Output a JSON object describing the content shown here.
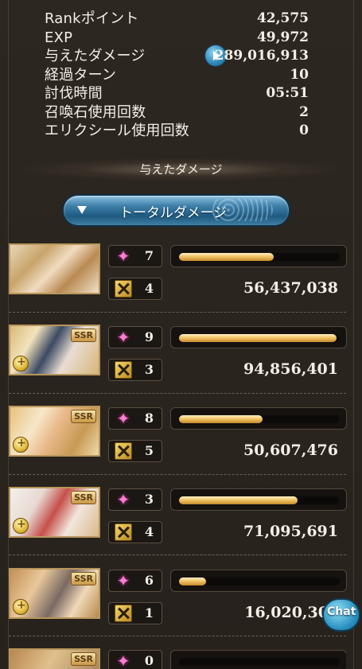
{
  "stats": [
    {
      "label": "Rankポイント",
      "value": "42,575"
    },
    {
      "label": "EXP",
      "value": "49,972"
    },
    {
      "label": "与えたダメージ",
      "value": "289,016,913"
    },
    {
      "label": "経過ターン",
      "value": "10"
    },
    {
      "label": "討伐時間",
      "value": "05:51"
    },
    {
      "label": "召喚石使用回数",
      "value": "2"
    },
    {
      "label": "エリクシール使用回数",
      "value": "0"
    }
  ],
  "section_title": "与えたダメージ",
  "dropdown_label": "トータルダメージ",
  "members": [
    {
      "ssr": "",
      "ability": "7",
      "special": "4",
      "damage": "56,437,038",
      "bar_fraction": 0.59
    },
    {
      "ssr": "SSR",
      "ability": "9",
      "special": "3",
      "damage": "94,856,401",
      "bar_fraction": 0.98
    },
    {
      "ssr": "SSR",
      "ability": "8",
      "special": "5",
      "damage": "50,607,476",
      "bar_fraction": 0.52
    },
    {
      "ssr": "SSR",
      "ability": "3",
      "special": "4",
      "damage": "71,095,691",
      "bar_fraction": 0.74
    },
    {
      "ssr": "SSR",
      "ability": "6",
      "special": "1",
      "damage": "16,020,30",
      "bar_fraction": 0.17
    },
    {
      "ssr": "SSR",
      "ability": "0",
      "special": "",
      "damage": "",
      "bar_fraction": 0.0
    }
  ],
  "chat_label": "Chat",
  "icons": {
    "play": "play-icon",
    "ability": "star-icon",
    "special": "crossed-swords-icon",
    "dropdown": "triangle-down-icon"
  },
  "colors": {
    "bar_fill": "#f1c466",
    "accent_blue": "#3d7fa9",
    "ability_star": "#ff7fd6"
  }
}
